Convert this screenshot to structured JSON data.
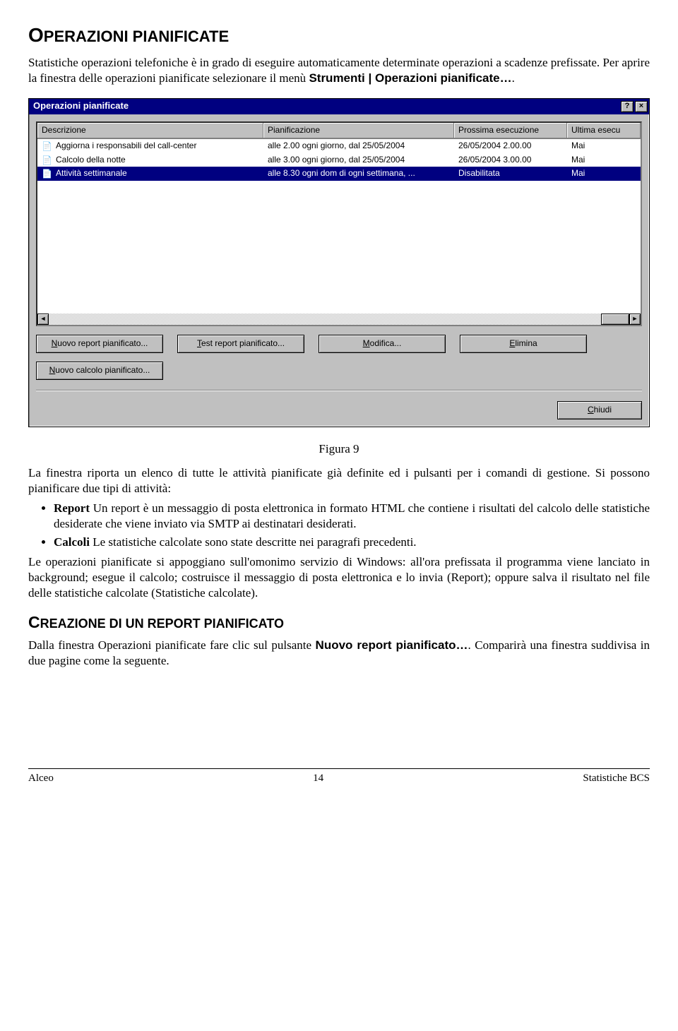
{
  "title_part1": "O",
  "title_part2": "PERAZIONI PIANIFICATE",
  "intro_1": "Statistiche operazioni telefoniche è in grado di eseguire automaticamente determinate operazioni a scadenze prefissate. Per aprire la finestra delle operazioni pianificate selezionare il menù ",
  "intro_menu": "Strumenti | Operazioni pianificate…",
  "intro_end": ".",
  "dialog": {
    "title": "Operazioni pianificate",
    "help": "?",
    "close": "×",
    "columns": {
      "desc": "Descrizione",
      "plan": "Pianificazione",
      "next": "Prossima esecuzione",
      "last": "Ultima esecu"
    },
    "rows": [
      {
        "desc": "Aggiorna i responsabili del call-center",
        "plan": "alle 2.00 ogni giorno, dal 25/05/2004",
        "next": "26/05/2004 2.00.00",
        "last": "Mai",
        "selected": false
      },
      {
        "desc": "Calcolo della notte",
        "plan": "alle 3.00 ogni giorno, dal 25/05/2004",
        "next": "26/05/2004 3.00.00",
        "last": "Mai",
        "selected": false
      },
      {
        "desc": "Attività settimanale",
        "plan": "alle 8.30 ogni dom di ogni settimana, ...",
        "next": "Disabilitata",
        "last": "Mai",
        "selected": true
      }
    ],
    "buttons": {
      "nuovo_report_pre": "N",
      "nuovo_report": "uovo report pianificato...",
      "test_pre": "T",
      "test": "est report pianificato...",
      "modifica_pre": "M",
      "modifica": "odifica...",
      "elimina_pre": "E",
      "elimina": "limina",
      "nuovo_calcolo_pre": "N",
      "nuovo_calcolo": "uovo calcolo pianificato...",
      "chiudi_pre": "C",
      "chiudi": "hiudi"
    }
  },
  "figcap": "Figura 9",
  "para2": "La finestra riporta un elenco di tutte le attività pianificate già definite ed i pulsanti per i comandi di gestione. Si possono pianificare due tipi di attività:",
  "bullets": [
    {
      "bold": "Report",
      "text": " Un report è un messaggio di posta elettronica in formato HTML che contiene i risultati del calcolo delle statistiche desiderate che viene inviato via SMTP ai destinatari desiderati."
    },
    {
      "bold": "Calcoli",
      "text": " Le statistiche calcolate sono state descritte nei paragrafi precedenti."
    }
  ],
  "para3": "Le operazioni pianificate si appoggiano sull'omonimo servizio di Windows: all'ora prefissata il programma viene lanciato in background; esegue il calcolo; costruisce il messaggio di posta elettronica e lo invia (Report); oppure salva il risultato nel file delle statistiche calcolate (Statistiche calcolate).",
  "sec2_cap": "C",
  "sec2_rest": "REAZIONE DI UN REPORT PIANIFICATO",
  "para4a": "Dalla finestra Operazioni pianificate fare clic sul pulsante ",
  "para4b": "Nuovo report pianificato…",
  "para4c": ". Comparirà una finestra suddivisa in due pagine come la seguente.",
  "footer": {
    "left": "Alceo",
    "center": "14",
    "right": "Statistiche BCS"
  }
}
